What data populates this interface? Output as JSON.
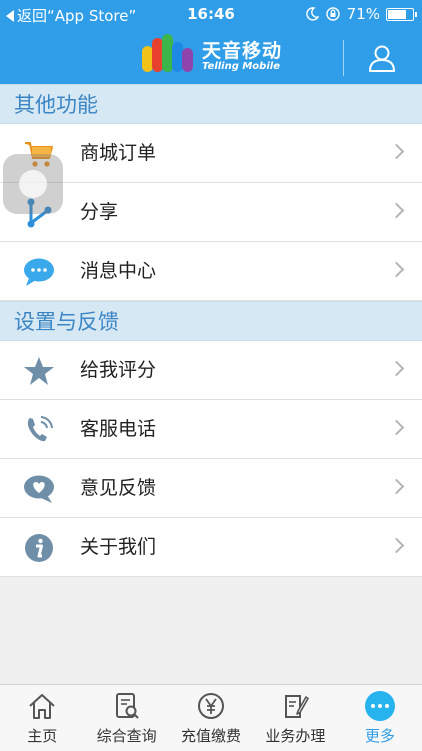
{
  "status": {
    "back_label": "返回“App Store”",
    "time": "16:46",
    "battery": "71%"
  },
  "header": {
    "brand_cn": "天音移动",
    "brand_en": "Telling Mobile"
  },
  "sections": [
    {
      "title": "其他功能",
      "items": [
        {
          "label": "商城订单",
          "icon": "shopping-cart-icon"
        },
        {
          "label": "分享",
          "icon": "share-icon"
        },
        {
          "label": "消息中心",
          "icon": "message-bubble-icon"
        }
      ]
    },
    {
      "title": "设置与反馈",
      "items": [
        {
          "label": "给我评分",
          "icon": "star-icon"
        },
        {
          "label": "客服电话",
          "icon": "phone-icon"
        },
        {
          "label": "意见反馈",
          "icon": "heart-bubble-icon"
        },
        {
          "label": "关于我们",
          "icon": "info-icon"
        }
      ]
    }
  ],
  "tabs": [
    {
      "label": "主页",
      "icon": "home-icon"
    },
    {
      "label": "综合查询",
      "icon": "search-document-icon"
    },
    {
      "label": "充值缴费",
      "icon": "yen-coin-icon"
    },
    {
      "label": "业务办理",
      "icon": "clipboard-pen-icon"
    },
    {
      "label": "更多",
      "icon": "more-icon",
      "active": true
    }
  ],
  "colors": {
    "primary": "#2f9de8",
    "section_bg": "#d7e8f5",
    "section_text": "#3b86c4",
    "icon_gray": "#6f8fa8"
  }
}
